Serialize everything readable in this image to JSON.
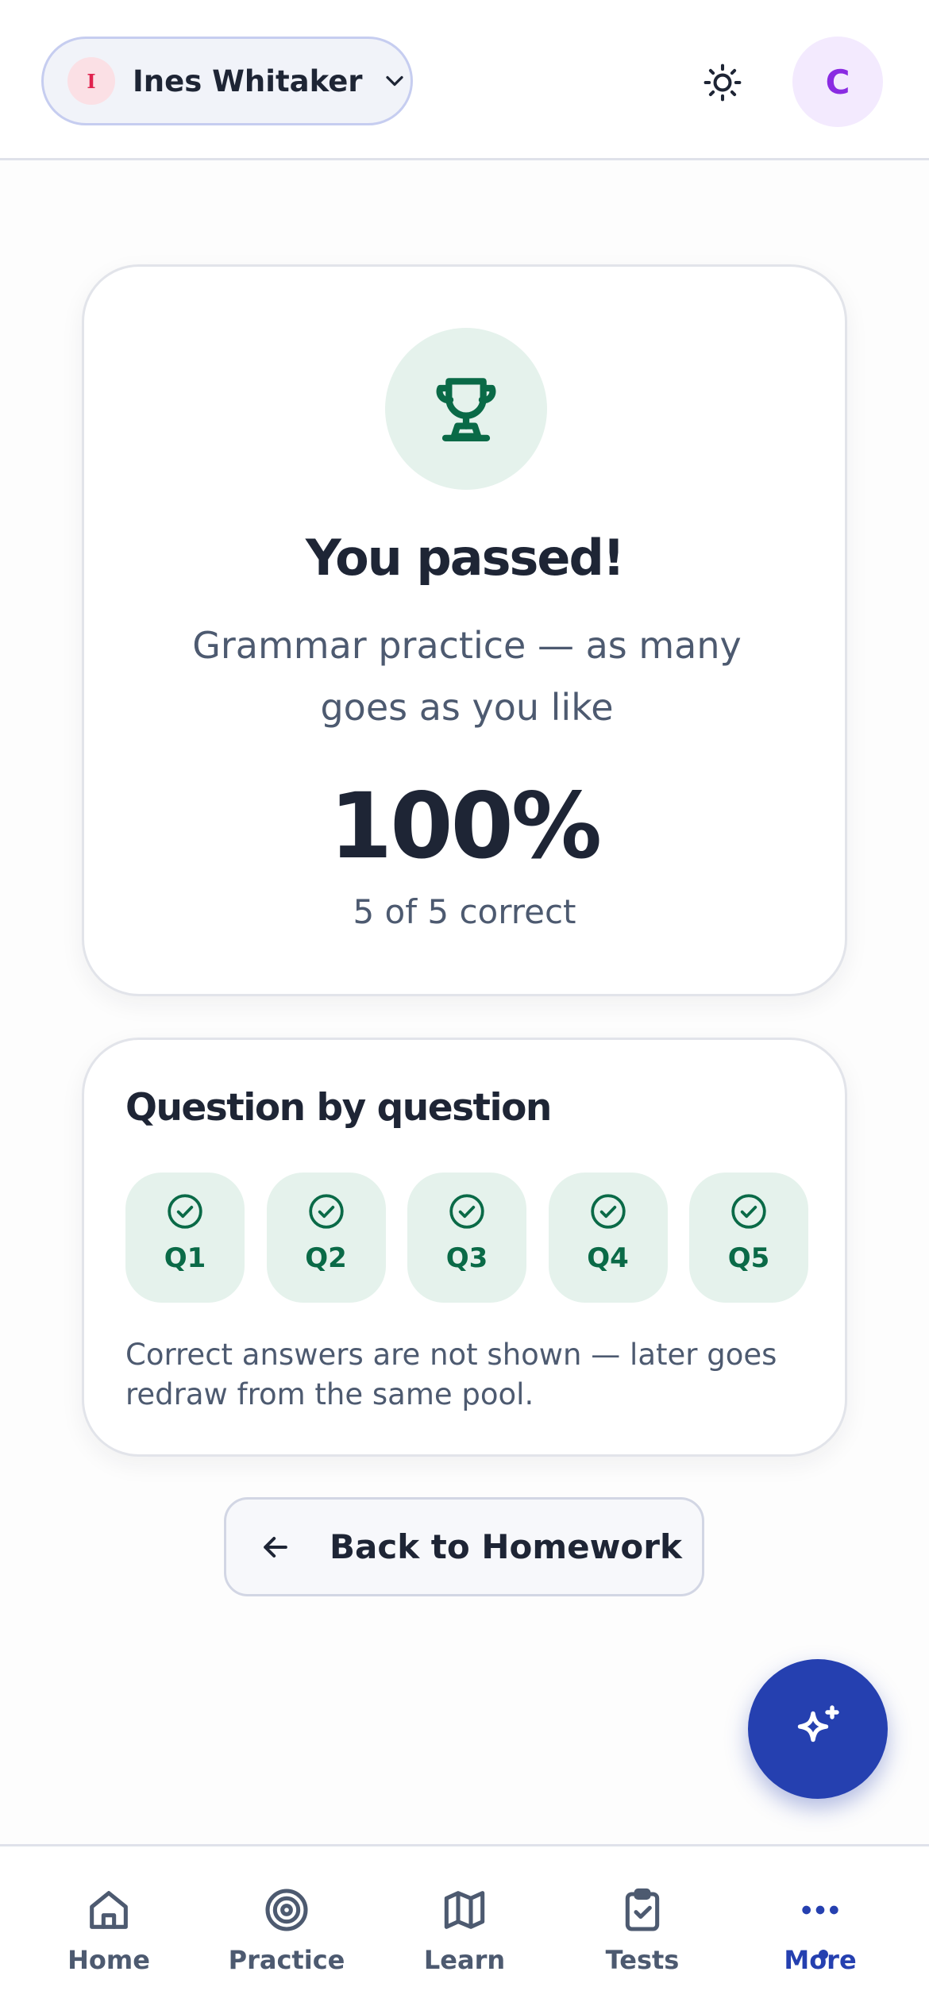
{
  "header": {
    "profile": {
      "initial": "I",
      "name": "Ines Whitaker"
    },
    "theme_icon": "sun-icon",
    "user_initial": "C"
  },
  "result": {
    "icon": "trophy-icon",
    "title": "You passed!",
    "subtitle": "Grammar practice — as many goes as you like",
    "score": "100%",
    "count": "5 of 5 correct"
  },
  "breakdown": {
    "title": "Question by question",
    "questions": [
      {
        "label": "Q1",
        "status": "correct"
      },
      {
        "label": "Q2",
        "status": "correct"
      },
      {
        "label": "Q3",
        "status": "correct"
      },
      {
        "label": "Q4",
        "status": "correct"
      },
      {
        "label": "Q5",
        "status": "correct"
      }
    ],
    "note": "Correct answers are not shown — later goes redraw from the same pool."
  },
  "back_button": {
    "label": "Back to Homework",
    "icon": "arrow-left-icon"
  },
  "fab": {
    "icon": "sparkle-icon"
  },
  "nav": {
    "items": [
      {
        "label": "Home",
        "icon": "home-icon",
        "active": false
      },
      {
        "label": "Practice",
        "icon": "target-icon",
        "active": false
      },
      {
        "label": "Learn",
        "icon": "map-icon",
        "active": false
      },
      {
        "label": "Tests",
        "icon": "clipboard-check-icon",
        "active": false
      },
      {
        "label": "More",
        "icon": "more-dots-icon",
        "active": true
      }
    ]
  },
  "colors": {
    "accent": "#2540b0",
    "success": "#0a6a47",
    "success_bg": "#e5f2ec",
    "text": "#1e2535",
    "muted": "#4d5a70"
  }
}
